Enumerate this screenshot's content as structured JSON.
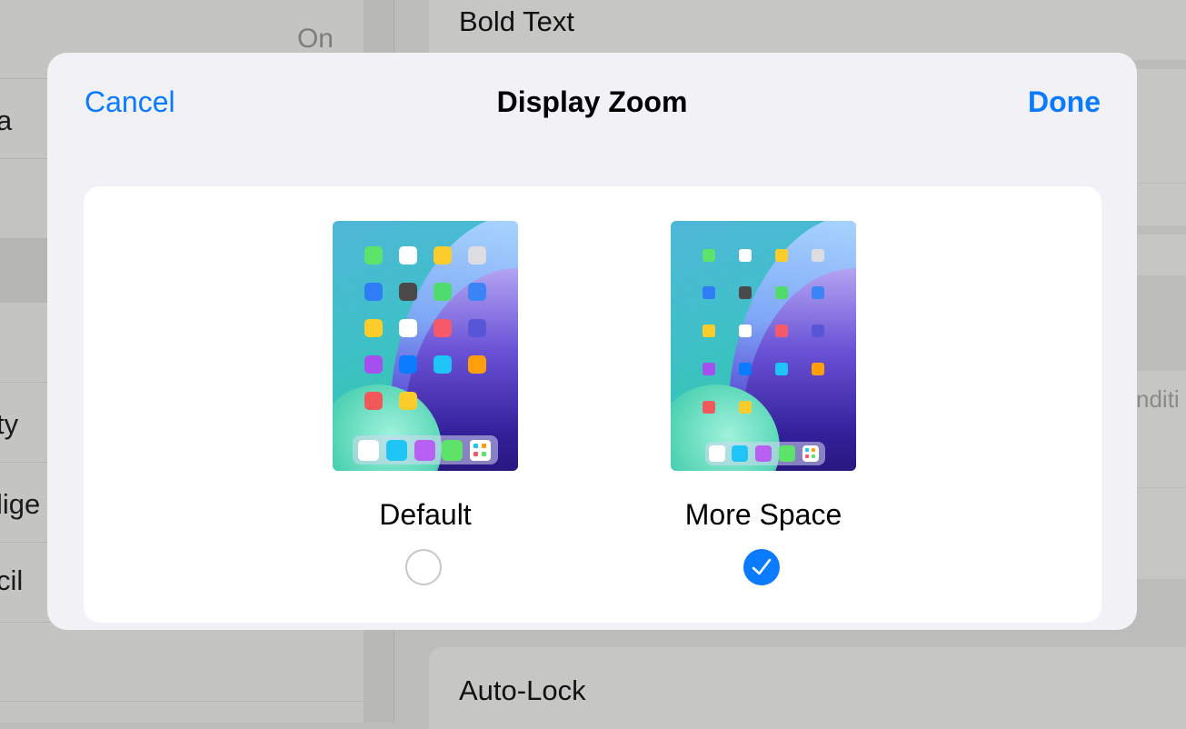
{
  "background": {
    "left_fragments": [
      "a",
      "ty",
      "lige",
      "cil"
    ],
    "left_status": "On",
    "right_title": "Bold Text",
    "right_fragment": "nditi",
    "right_bottom": "Auto-Lock"
  },
  "modal": {
    "cancel_label": "Cancel",
    "title": "Display Zoom",
    "done_label": "Done"
  },
  "options": [
    {
      "label": "Default",
      "selected": false
    },
    {
      "label": "More Space",
      "selected": true
    }
  ],
  "colors": {
    "accent": "#0a7aff",
    "modal_bg": "#f1f1f6",
    "card_bg": "#ffffff"
  }
}
